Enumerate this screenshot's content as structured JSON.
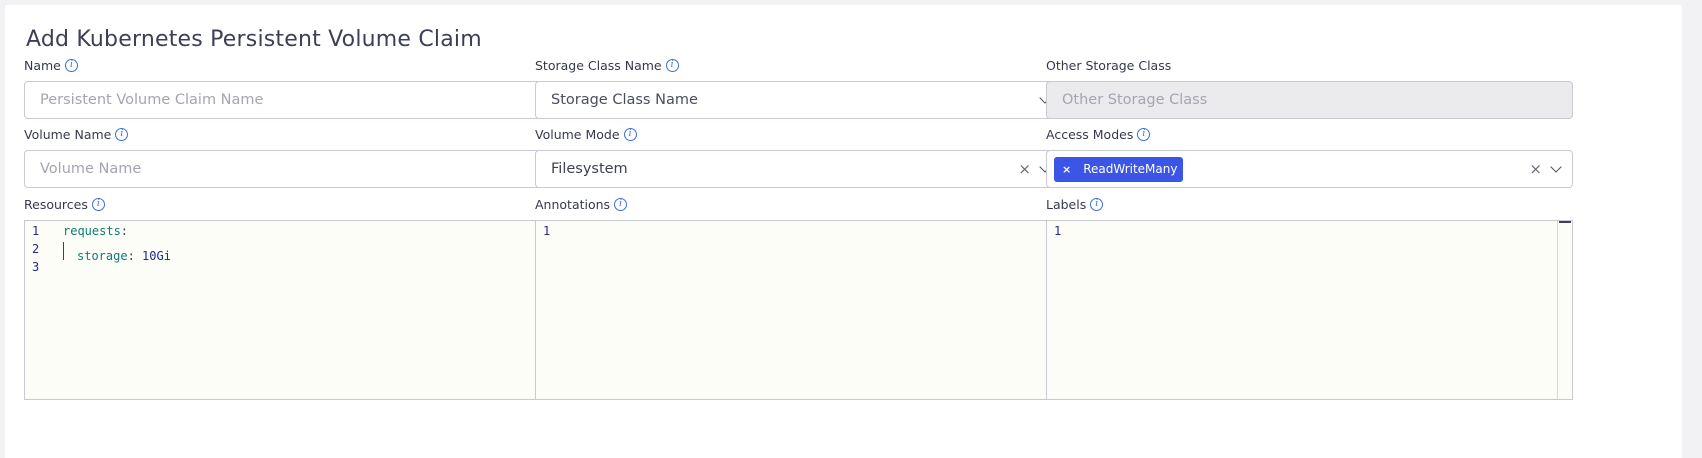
{
  "title": "Add Kubernetes Persistent Volume Claim",
  "fields": {
    "name": {
      "label": "Name",
      "placeholder": "Persistent Volume Claim Name"
    },
    "storage_class_name": {
      "label": "Storage Class Name",
      "placeholder": "Storage Class Name"
    },
    "other_storage_class": {
      "label": "Other Storage Class",
      "placeholder": "Other Storage Class"
    },
    "volume_name": {
      "label": "Volume Name",
      "placeholder": "Volume Name"
    },
    "volume_mode": {
      "label": "Volume Mode",
      "value": "Filesystem"
    },
    "access_modes": {
      "label": "Access Modes",
      "tags": [
        "ReadWriteMany"
      ]
    },
    "resources": {
      "label": "Resources",
      "lines": [
        {
          "no": "1",
          "key": "requests",
          "sep": ":",
          "val": ""
        },
        {
          "no": "2",
          "key": "storage",
          "sep": ": ",
          "val": "10Gi"
        },
        {
          "no": "3",
          "key": "",
          "sep": "",
          "val": ""
        }
      ]
    },
    "annotations": {
      "label": "Annotations",
      "lines": [
        {
          "no": "1"
        }
      ]
    },
    "labels": {
      "label": "Labels",
      "lines": [
        {
          "no": "1"
        }
      ]
    }
  },
  "icons": {
    "info": "info-icon",
    "clear": "clear-icon",
    "dropdown": "chevron-down-icon",
    "tag_remove": "tag-remove-icon"
  },
  "symbols": {
    "info": "i",
    "clear": "×",
    "tag_remove": "×"
  },
  "colors": {
    "accent": "#3b55e6",
    "info": "#3b6fd6",
    "title": "#3c3f55",
    "editor_bg": "#fdfdf8",
    "disabled_bg": "#ebebed"
  }
}
